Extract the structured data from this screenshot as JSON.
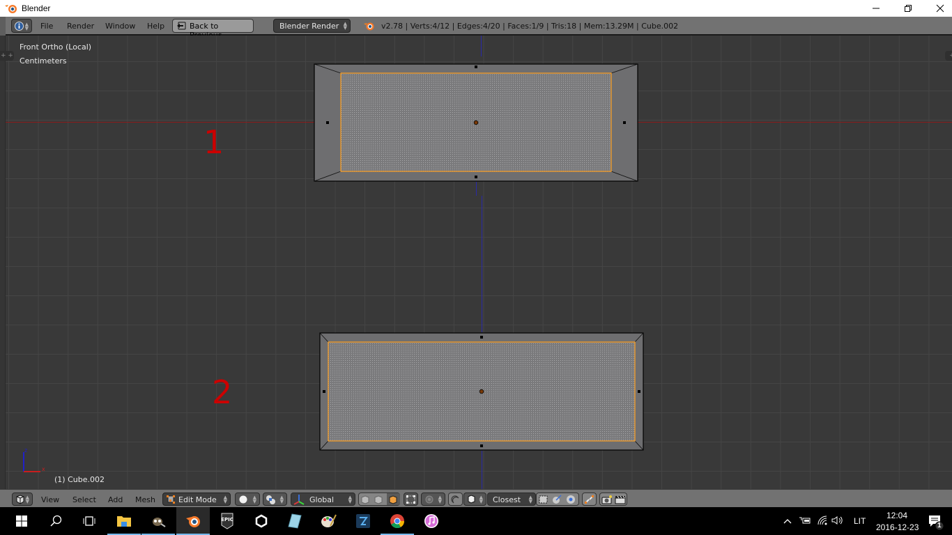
{
  "window": {
    "title": "Blender",
    "controls": {
      "minimize": "minimize-icon",
      "restore": "restore-icon",
      "close": "close-icon"
    }
  },
  "info_header": {
    "editor_type_icon": "info-icon",
    "menus": [
      "File",
      "Render",
      "Window",
      "Help"
    ],
    "back_button": "Back to Previous",
    "render_engine": "Blender Render",
    "stats": "v2.78 | Verts:4/12 | Edges:4/20 | Faces:1/9 | Tris:18 | Mem:13.29M | Cube.002"
  },
  "viewport": {
    "view_name": "Front Ortho (Local)",
    "units": "Centimeters",
    "object_label": "(1) Cube.002",
    "annotations": [
      "1",
      "2"
    ],
    "axis_labels": {
      "z": "z",
      "x": "x"
    },
    "colors": {
      "background": "#393939",
      "grid": "#454545",
      "x_axis": "#8a1c1c",
      "z_axis": "#2a2aa8",
      "selection_edge": "#ffa020",
      "face": "#6e6e70",
      "annotation": "#cc0000"
    },
    "meshes": [
      {
        "name": "mesh-1",
        "selected_faces": 1,
        "label": "1"
      },
      {
        "name": "mesh-2",
        "selected_faces": 1,
        "label": "2"
      }
    ]
  },
  "view3d_header": {
    "menus": [
      "View",
      "Select",
      "Add",
      "Mesh"
    ],
    "mode": "Edit Mode",
    "transform_orientation": "Global",
    "snap_target": "Closest",
    "icons": [
      "editor-cube-icon",
      "viewport-shading-icon",
      "pivot-point-icon",
      "manipulator-icon",
      "vertex-select-icon",
      "edge-select-icon",
      "face-select-icon",
      "limit-selection-icon",
      "proportional-edit-icon",
      "snap-magnet-icon",
      "snap-element-icon",
      "snap-self-icon",
      "align-rotation-icon",
      "project-individual-icon",
      "retopology-icon",
      "render-still-icon",
      "render-animation-icon"
    ]
  },
  "taskbar": {
    "apps": [
      "start",
      "search",
      "task-view",
      "file-explorer",
      "gimp",
      "blender",
      "epic-games",
      "unity",
      "notepad",
      "paint",
      "blender-launcher",
      "chrome",
      "itunes"
    ],
    "active_app": "blender",
    "language": "LIT",
    "time": "12:04",
    "date": "2016-12-23",
    "notifications": "1"
  }
}
